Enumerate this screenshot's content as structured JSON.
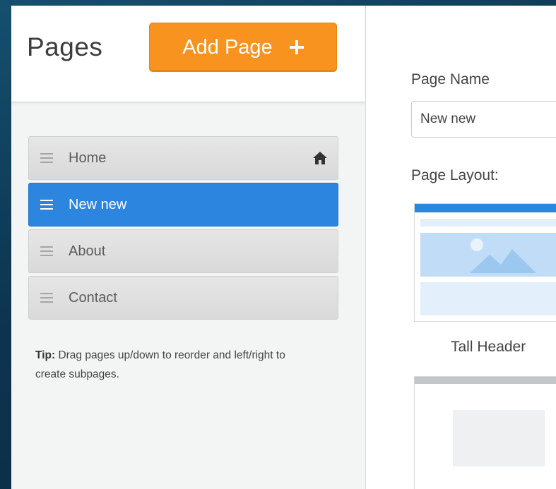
{
  "sidebar": {
    "title": "Pages",
    "add_button_label": "Add Page",
    "pages": [
      {
        "label": "Home",
        "is_home": true,
        "active": false
      },
      {
        "label": "New new",
        "is_home": false,
        "active": true
      },
      {
        "label": "About",
        "is_home": false,
        "active": false
      },
      {
        "label": "Contact",
        "is_home": false,
        "active": false
      }
    ],
    "tip_prefix": "Tip:",
    "tip_text": "Drag pages up/down to reorder and left/right to create subpages."
  },
  "main": {
    "page_name_label": "Page Name",
    "page_name_value": "New new",
    "page_layout_label": "Page Layout:",
    "layouts": [
      {
        "caption": "Tall Header",
        "selected": true
      },
      {
        "caption": "",
        "selected": false
      }
    ]
  },
  "colors": {
    "accent_orange": "#f7931e",
    "active_blue": "#2c85de",
    "background_teal": "#0d3550"
  },
  "icons": {
    "plus": "plus-icon",
    "drag": "drag-handle-icon",
    "home": "home-icon",
    "image": "image-placeholder-icon"
  }
}
